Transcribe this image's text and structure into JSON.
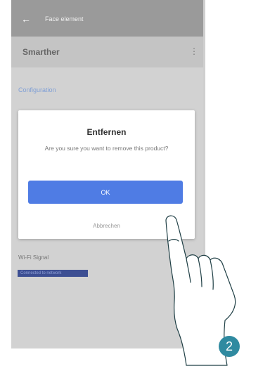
{
  "topbar": {
    "back_icon": "←",
    "title": "Face element"
  },
  "device": {
    "name": "Smarther",
    "menu_icon": "⋮"
  },
  "section_link": "Configuration",
  "below_label": "Wi-Fi Signal",
  "chip_text": "Connected to network",
  "dialog": {
    "title": "Entfernen",
    "message": "Are you sure you want to remove this product?",
    "ok_label": "OK",
    "cancel_label": "Abbrechen"
  },
  "step_number": "2",
  "colors": {
    "accent": "#4f7ce4",
    "badge": "#2f8aa0",
    "chip": "#3d4f93"
  }
}
